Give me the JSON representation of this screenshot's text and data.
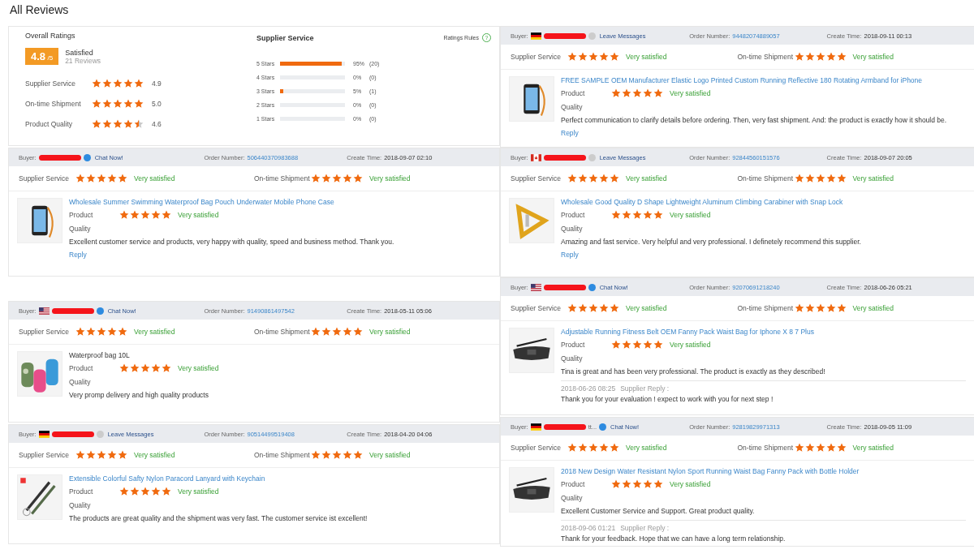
{
  "page_title": "All Reviews",
  "columns": [
    {
      "summary": {
        "title": "Overall Ratings",
        "score": "4.8",
        "out_of": "/5",
        "verdict": "Satisfied",
        "count": "21 Reviews",
        "rows": [
          {
            "label": "Supplier Service",
            "stars": 5,
            "value": "4.9"
          },
          {
            "label": "On-time Shipment",
            "stars": 5,
            "value": "5.0"
          },
          {
            "label": "Product Quality",
            "stars": 4.5,
            "value": "4.6"
          }
        ],
        "breakdown_title": "Supplier Service",
        "rules": "Ratings Rules",
        "rules_icon": "?",
        "breakdown": [
          {
            "label": "5 Stars",
            "level": 0.95,
            "percent": "95%",
            "count": "(20)"
          },
          {
            "label": "4 Stars",
            "level": 0,
            "percent": "0%",
            "count": "(0)"
          },
          {
            "label": "3 Stars",
            "level": 0.05,
            "percent": "5%",
            "count": "(1)"
          },
          {
            "label": "2 Stars",
            "level": 0,
            "percent": "0%",
            "count": "(0)"
          },
          {
            "label": "1 Stars",
            "level": 0,
            "percent": "0%",
            "count": "(0)"
          }
        ]
      },
      "reviews": [
        {
          "buyer_label": "Buyer:",
          "contact": {
            "kind": "chat",
            "label": "Chat Now!"
          },
          "order_label": "Order Number:",
          "order": "506440370983688",
          "time_label": "Create Time:",
          "time": "2018-09-07 02:10",
          "ratings": [
            {
              "label": "Supplier Service",
              "stars": 5,
              "verdict": "Very satisfied"
            },
            {
              "label": "On-time Shipment",
              "stars": 5,
              "verdict": "Very satisfied"
            }
          ],
          "title": "Wholesale Summer Swimming Waterproof Bag Pouch Underwater Mobile Phone Case",
          "title_link": true,
          "product_rating": {
            "label": "Product Quality",
            "stars": 5,
            "verdict": "Very satisfied"
          },
          "comment": "Excellent customer service and products, very happy with quality, speed and business method. Thank you.",
          "reply_link": "Reply"
        },
        {
          "flag": {
            "kind": "us"
          },
          "buyer_label": "Buyer:",
          "contact": {
            "kind": "chat",
            "label": "Chat Now!"
          },
          "order_label": "Order Number:",
          "order": "91490861497542",
          "time_label": "Create Time:",
          "time": "2018-05-11 05:06",
          "ratings": [
            {
              "label": "Supplier Service",
              "stars": 5,
              "verdict": "Very satisfied"
            },
            {
              "label": "On-time Shipment",
              "stars": 5,
              "verdict": "Very satisfied"
            }
          ],
          "title": "Waterproof bag 10L",
          "title_link": false,
          "product_rating": {
            "label": "Product Quality",
            "stars": 5,
            "verdict": "Very satisfied"
          },
          "comment": "Very promp delivery and high quality products"
        },
        {
          "flag": {
            "kind": "de"
          },
          "buyer_label": "Buyer:",
          "contact": {
            "kind": "message",
            "label": "Leave Messages"
          },
          "order_label": "Order Number:",
          "order": "90514499519408",
          "time_label": "Create Time:",
          "time": "2018-04-20 04:06",
          "ratings": [
            {
              "label": "Supplier Service",
              "stars": 5,
              "verdict": "Very satisfied"
            },
            {
              "label": "On-time Shipment",
              "stars": 5,
              "verdict": "Very satisfied"
            }
          ],
          "title": "Extensible Colorful Safty Nylon Paracord Lanyard with Keychain",
          "title_link": true,
          "product_rating": {
            "label": "Product Quality",
            "stars": 5,
            "verdict": "Very satisfied"
          },
          "comment": "The products are great quality and the shipment was very fast. The customer service ist excellent!"
        }
      ]
    },
    {
      "reviews": [
        {
          "flag": {
            "kind": "de"
          },
          "buyer_label": "Buyer:",
          "contact": {
            "kind": "message",
            "label": "Leave Messages"
          },
          "order_label": "Order Number:",
          "order": "94482074889057",
          "time_label": "Create Time:",
          "time": "2018-09-11 00:13",
          "ratings": [
            {
              "label": "Supplier Service",
              "stars": 5,
              "verdict": "Very satisfied"
            },
            {
              "label": "On-time Shipment",
              "stars": 5,
              "verdict": "Very satisfied"
            }
          ],
          "title": "FREE SAMPLE OEM Manufacturer Elastic Logo Printed Custom Running Reflective 180 Rotating Armband for iPhone",
          "title_link": true,
          "product_rating": {
            "label": "Product Quality",
            "stars": 5,
            "verdict": "Very satisfied"
          },
          "comment": "Perfect communication to clarify details before ordering. Then, very fast shipment. And: the product is exactly how it should be.",
          "reply_link": "Reply"
        },
        {
          "flag": {
            "kind": "ca"
          },
          "buyer_label": "Buyer:",
          "contact": {
            "kind": "message",
            "label": "Leave Messages"
          },
          "order_label": "Order Number:",
          "order": "92844560151576",
          "time_label": "Create Time:",
          "time": "2018-09-07 20:05",
          "ratings": [
            {
              "label": "Supplier Service",
              "stars": 5,
              "verdict": "Very satisfied"
            },
            {
              "label": "On-time Shipment",
              "stars": 5,
              "verdict": "Very satisfied"
            }
          ],
          "title": "Wholesale Good Quality D Shape Lightweight Aluminum Climbing Carabiner with Snap Lock",
          "title_link": true,
          "product_rating": {
            "label": "Product Quality",
            "stars": 5,
            "verdict": "Very satisfied"
          },
          "comment": "Amazing and fast service. Very helpful and very professional. I definetely recommend this supplier.",
          "reply_link": "Reply"
        },
        {
          "flag": {
            "kind": "us"
          },
          "buyer_label": "Buyer:",
          "contact": {
            "kind": "chat",
            "label": "Chat Now!"
          },
          "order_label": "Order Number:",
          "order": "92070691218240",
          "time_label": "Create Time:",
          "time": "2018-06-26 05:21",
          "ratings": [
            {
              "label": "Supplier Service",
              "stars": 5,
              "verdict": "Very satisfied"
            },
            {
              "label": "On-time Shipment",
              "stars": 5,
              "verdict": "Very satisfied"
            }
          ],
          "title": "Adjustable Running Fitness Belt OEM Fanny Pack Waist Bag for Iphone X 8 7 Plus",
          "title_link": true,
          "product_rating": {
            "label": "Product Quality",
            "stars": 5,
            "verdict": "Very satisfied"
          },
          "comment": "Tina is great and has been very professional. The product is exactly as they described!",
          "reply_time": "2018-06-26 08:25",
          "reply_label": "Supplier Reply :",
          "reply_text": "Thank you for your evaluation ! expect to work with you for next step !"
        },
        {
          "flag": {
            "kind": "de"
          },
          "buyer_label": "Buyer:",
          "buyer_suffix": "tt...",
          "contact": {
            "kind": "chat",
            "label": "Chat Now!"
          },
          "order_label": "Order Number:",
          "order": "92819829971313",
          "time_label": "Create Time:",
          "time": "2018-09-05 11:09",
          "ratings": [
            {
              "label": "Supplier Service",
              "stars": 5,
              "verdict": "Very satisfied"
            },
            {
              "label": "On-time Shipment",
              "stars": 5,
              "verdict": "Very satisfied"
            }
          ],
          "title": "2018 New Design Water Resistant Nylon Sport Running Waist Bag Fanny Pack with Bottle Holder",
          "title_link": true,
          "product_rating": {
            "label": "Product Quality",
            "stars": 5,
            "verdict": "Very satisfied"
          },
          "comment": "Excellent Customer Service and Support. Great product quality.",
          "reply_time": "2018-09-06 01:21",
          "reply_label": "Supplier Reply :",
          "reply_text": "Thank for your feedback. Hope that we can have a long term relationship."
        }
      ]
    }
  ]
}
